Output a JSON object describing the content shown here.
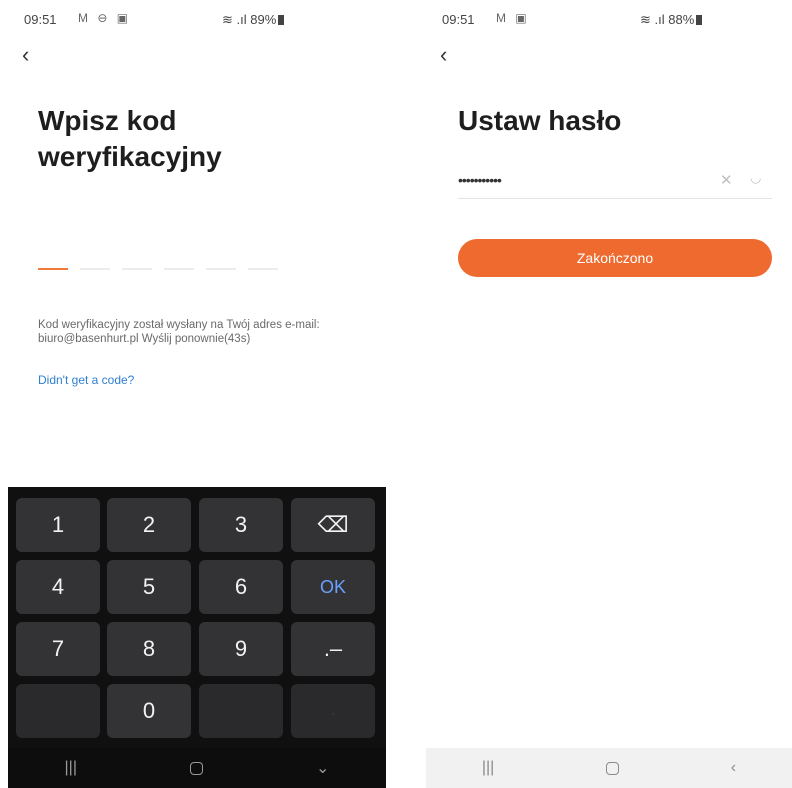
{
  "left": {
    "status": {
      "time": "09:51",
      "notif_icons": "M ⊖ ▣",
      "system": "≋ .ıl 89%"
    },
    "back_icon": "‹",
    "title_line1": "Wpisz kod",
    "title_line2": "weryfikacyjny",
    "info_line1": "Kod weryfikacyjny został wysłany na Twój adres e-mail:",
    "info_line2": "biuro@basenhurt.pl  Wyślij ponownie(43s)",
    "link": "Didn't get a code?",
    "keyboard": {
      "k1": "1",
      "k2": "2",
      "k3": "3",
      "backspace": "⌫",
      "k4": "4",
      "k5": "5",
      "k6": "6",
      "ok": "OK",
      "k7": "7",
      "k8": "8",
      "k9": "9",
      "dotdash": ".–",
      "k0": "0",
      "comma": ","
    },
    "nav": {
      "recents": "|||",
      "back": "⌄"
    }
  },
  "right": {
    "status": {
      "time": "09:51",
      "notif_icons": "M ▣",
      "system": "≋ .ıl 88%"
    },
    "back_icon": "‹",
    "title": "Ustaw hasło",
    "password_mask": "•••••••••••",
    "clear_icon": "✕",
    "eye_icon": "◡",
    "submit": "Zakończono",
    "nav": {
      "recents": "|||",
      "back": "‹"
    }
  },
  "colors": {
    "accent": "#ef6a2f",
    "link": "#2f7fd0",
    "keyboard_bg": "#101010",
    "key_bg": "#333335",
    "ok": "#6aa0ff"
  }
}
